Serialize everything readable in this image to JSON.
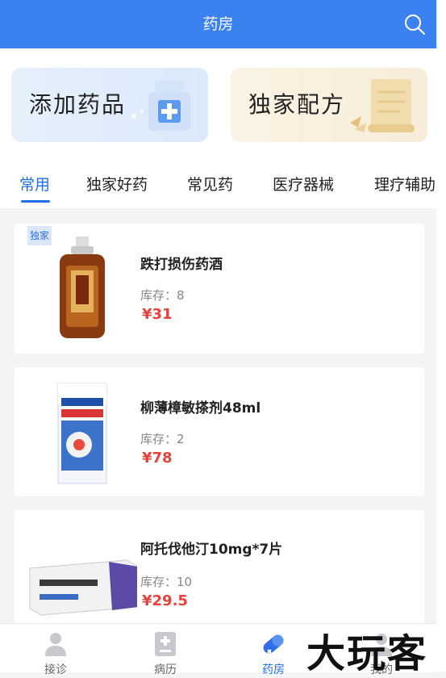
{
  "header": {
    "title": "药房"
  },
  "banners": [
    {
      "label": "添加药品"
    },
    {
      "label": "独家配方"
    }
  ],
  "tabs": [
    "常用",
    "独家好药",
    "常见药",
    "医疗器械",
    "理疗辅助"
  ],
  "products": [
    {
      "badge": "独家",
      "name": "跌打损伤药酒",
      "stock": "库存：8",
      "price": "¥31"
    },
    {
      "name": "柳薄樟敏搽剂48ml",
      "stock": "库存：2",
      "price": "¥78"
    },
    {
      "name": "阿托伐他汀10mg*7片",
      "stock": "库存：10",
      "price": "¥29.5"
    }
  ],
  "tabbar": [
    {
      "label": "接诊",
      "icon": "doctor-icon"
    },
    {
      "label": "病历",
      "icon": "medical-record-icon"
    },
    {
      "label": "药房",
      "icon": "pill-icon"
    },
    {
      "label": "我的",
      "icon": "profile-icon"
    }
  ],
  "watermark": "大玩客",
  "colors": {
    "primary": "#3b82f0",
    "active": "#1f6fe6",
    "price": "#e9423a"
  }
}
